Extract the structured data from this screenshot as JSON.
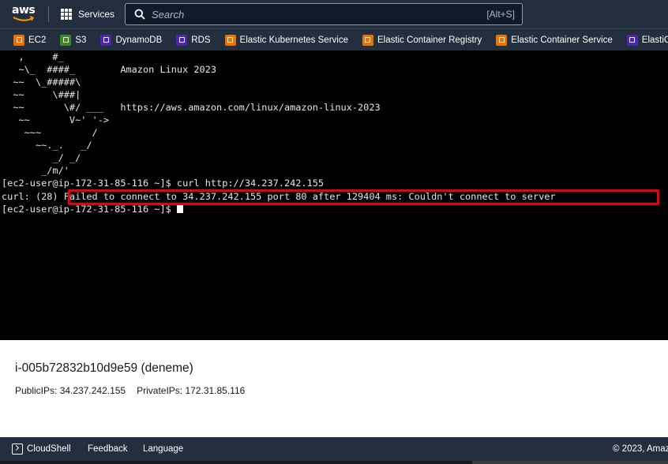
{
  "nav": {
    "logo_text": "aws",
    "services_label": "Services",
    "search_placeholder": "Search",
    "search_shortcut": "[Alt+S]"
  },
  "favorites": [
    {
      "label": "EC2",
      "icon": "ec2-icon",
      "color": "#ed7100"
    },
    {
      "label": "S3",
      "icon": "s3-icon",
      "color": "#3f8624"
    },
    {
      "label": "DynamoDB",
      "icon": "dynamodb-icon",
      "color": "#4d27aa"
    },
    {
      "label": "RDS",
      "icon": "rds-icon",
      "color": "#4d27aa"
    },
    {
      "label": "Elastic Kubernetes Service",
      "icon": "eks-icon",
      "color": "#ed7100"
    },
    {
      "label": "Elastic Container Registry",
      "icon": "ecr-icon",
      "color": "#ed7100"
    },
    {
      "label": "Elastic Container Service",
      "icon": "ecs-icon",
      "color": "#ed7100"
    },
    {
      "label": "ElastiCache",
      "icon": "elasticache-icon",
      "color": "#4d27aa"
    }
  ],
  "terminal": {
    "lines": [
      "   ,     #_",
      "   ~\\_  ####_        Amazon Linux 2023",
      "  ~~  \\_#####\\",
      "  ~~     \\###|",
      "  ~~       \\#/ ___   https://aws.amazon.com/linux/amazon-linux-2023",
      "   ~~       V~' '->",
      "    ~~~         /",
      "      ~~._.   _/",
      "         _/ _/",
      "       _/m/'",
      "[ec2-user@ip-172-31-85-116 ~]$ curl http://34.237.242.155",
      "curl: (28) Failed to connect to 34.237.242.155 port 80 after 129404 ms: Couldn't connect to server",
      "[ec2-user@ip-172-31-85-116 ~]$ "
    ],
    "highlight_color": "#e60012"
  },
  "instance": {
    "title": "i-005b72832b10d9e59 (deneme)",
    "public_ips": "PublicIPs: 34.237.242.155",
    "private_ips": "PrivateIPs: 172.31.85.116"
  },
  "footer": {
    "cloudshell": "CloudShell",
    "feedback": "Feedback",
    "language": "Language",
    "copyright": "© 2023, Amaz"
  },
  "colors": {
    "nav_bg": "#232f3e",
    "terminal_bg": "#000000",
    "terminal_fg": "#e6e6e6"
  }
}
